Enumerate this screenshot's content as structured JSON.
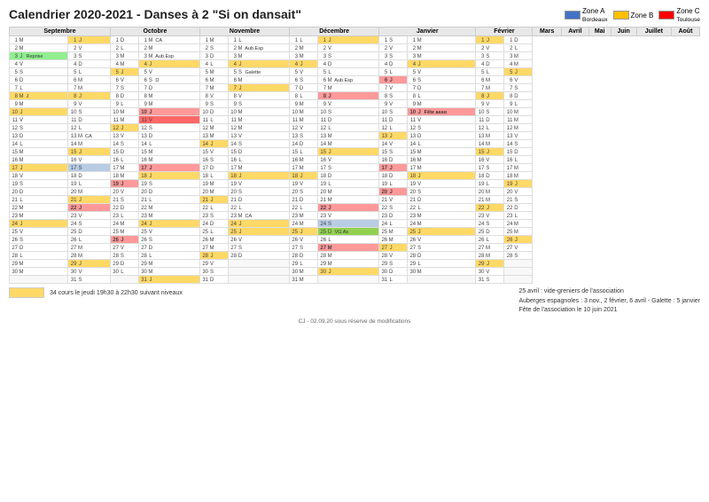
{
  "title": "Calendrier 2020-2021 - Danses à 2 \"Si on dansait\"",
  "zones": [
    {
      "label": "Zone A",
      "sublabel": "Bordeaux",
      "color": "zone-a"
    },
    {
      "label": "Zone B",
      "color": "zone-b"
    },
    {
      "label": "Zone C",
      "sublabel": "Toulouse",
      "color": "zone-c"
    }
  ],
  "footer_legend": "34 cours le jeudi 19h30 à 22h30 suivant niveaux",
  "footer_notes": [
    "25 avril : vide-greniers de l'association",
    "Auberges espagnoles : 3 nov., 2 février, 6 avril - Galette : 5 janvier",
    "Fête de l'association le 10 juin 2021"
  ],
  "footer_credit": "CJ - 02.09.20 sous réserve de modifications",
  "months": [
    "Septembre",
    "Octobre",
    "Novembre",
    "Décembre",
    "Janvier",
    "Février",
    "Mars",
    "Avril",
    "Mai",
    "Juin",
    "Juillet",
    "Août"
  ]
}
